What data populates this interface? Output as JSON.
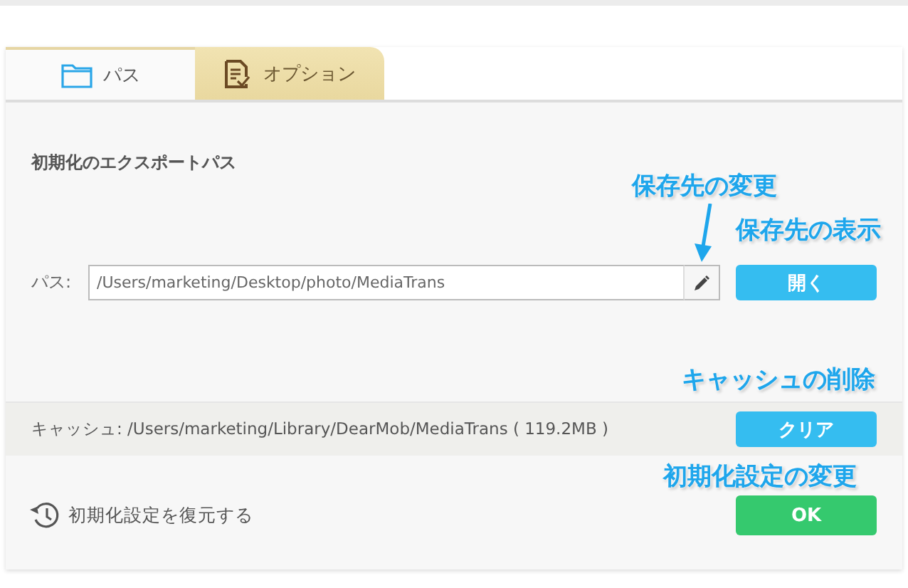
{
  "tabs": [
    {
      "label": "パス",
      "selected": false
    },
    {
      "label": "オプション",
      "selected": true
    }
  ],
  "export_path": {
    "heading": "初期化のエクスポートパス",
    "label": "パス:",
    "value": "/Users/marketing/Desktop/photo/MediaTrans",
    "open_button": "開く"
  },
  "cache": {
    "text": "キャッシュ: /Users/marketing/Library/DearMob/MediaTrans ( 119.2MB )",
    "clear_button": "クリア"
  },
  "footer": {
    "restore_link": "初期化設定を復元する",
    "ok_button": "OK"
  },
  "callouts": [
    {
      "text": "保存先の変更"
    },
    {
      "text": "保存先の表示"
    },
    {
      "text": "キャッシュの削除"
    },
    {
      "text": "初期化設定の変更"
    }
  ]
}
